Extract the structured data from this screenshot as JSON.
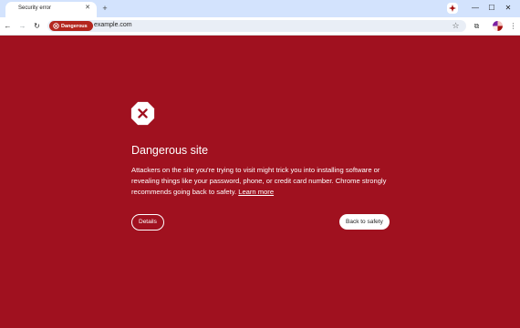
{
  "browser": {
    "tab": {
      "title": "Security error",
      "close_glyph": "✕"
    },
    "new_tab_glyph": "+",
    "window_controls": {
      "minimize_glyph": "—",
      "maximize_glyph": "☐",
      "close_glyph": "✕"
    },
    "toolbar": {
      "back_glyph": "←",
      "forward_glyph": "→",
      "reload_glyph": "↻",
      "security_chip_label": "Dangerous",
      "url": "example.com",
      "bookmark_glyph": "☆",
      "extensions_glyph": "⧉",
      "menu_glyph": "⋮"
    }
  },
  "interstitial": {
    "icon": "warning-octagon-x-icon",
    "heading": "Dangerous site",
    "body": "Attackers on the site you're trying to visit might trick you into installing software or revealing things like your password, phone, or credit card number. Chrome strongly recommends going back to safety.",
    "learn_more": "Learn more",
    "details_button": "Details",
    "back_button": "Back to safety"
  },
  "colors": {
    "page_background": "#a0111f",
    "tab_strip": "#d3e3fd",
    "danger_chip": "#b3261e",
    "text_on_danger": "#ffffff"
  }
}
